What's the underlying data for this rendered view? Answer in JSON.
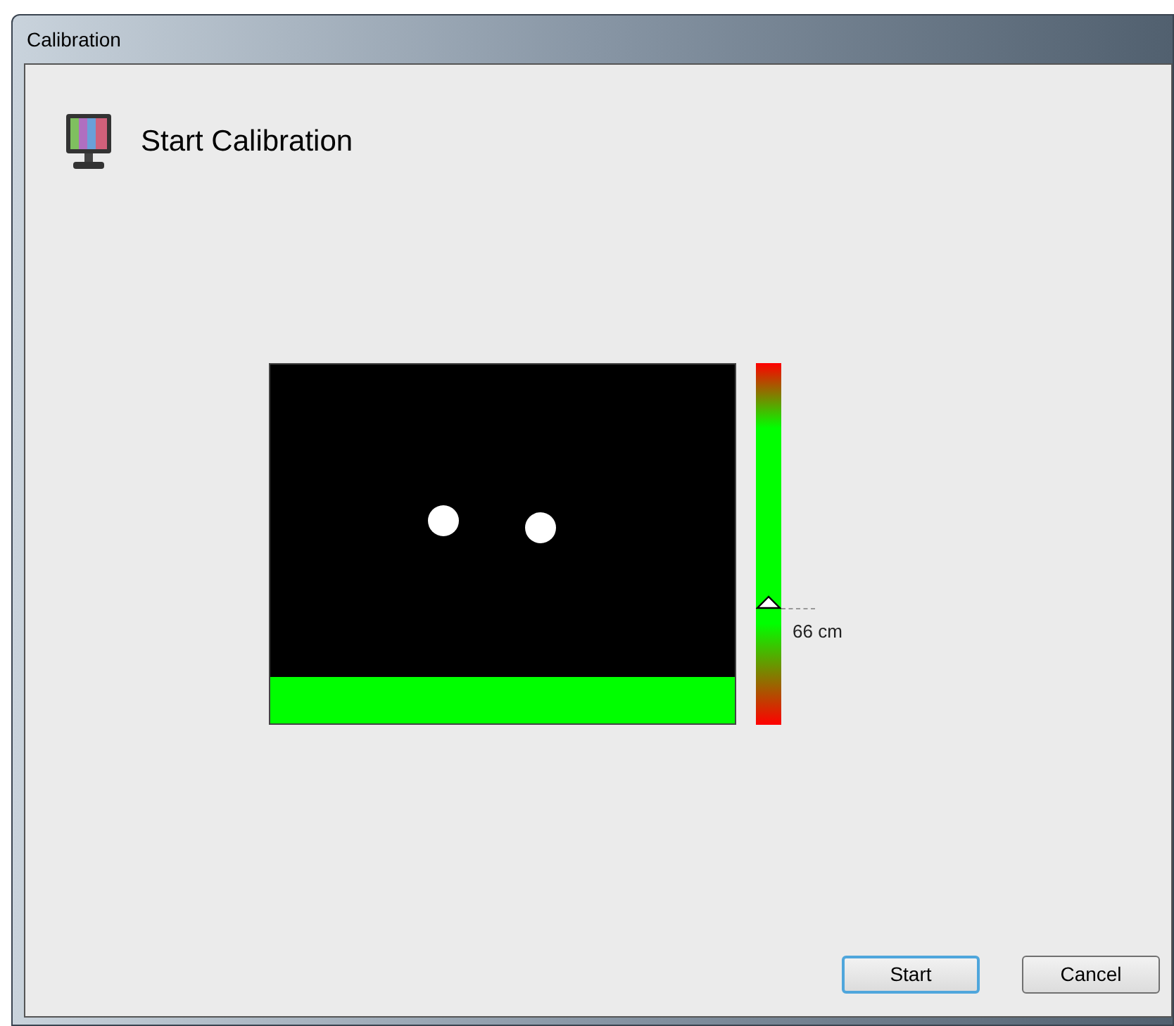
{
  "window": {
    "title": "Calibration"
  },
  "header": {
    "title": "Start Calibration"
  },
  "distance": {
    "level": 0.32,
    "reading": "66 cm"
  },
  "buttons": [
    {
      "label": "Start",
      "selected": true
    },
    {
      "label": "Cancel",
      "selected": false
    }
  ]
}
